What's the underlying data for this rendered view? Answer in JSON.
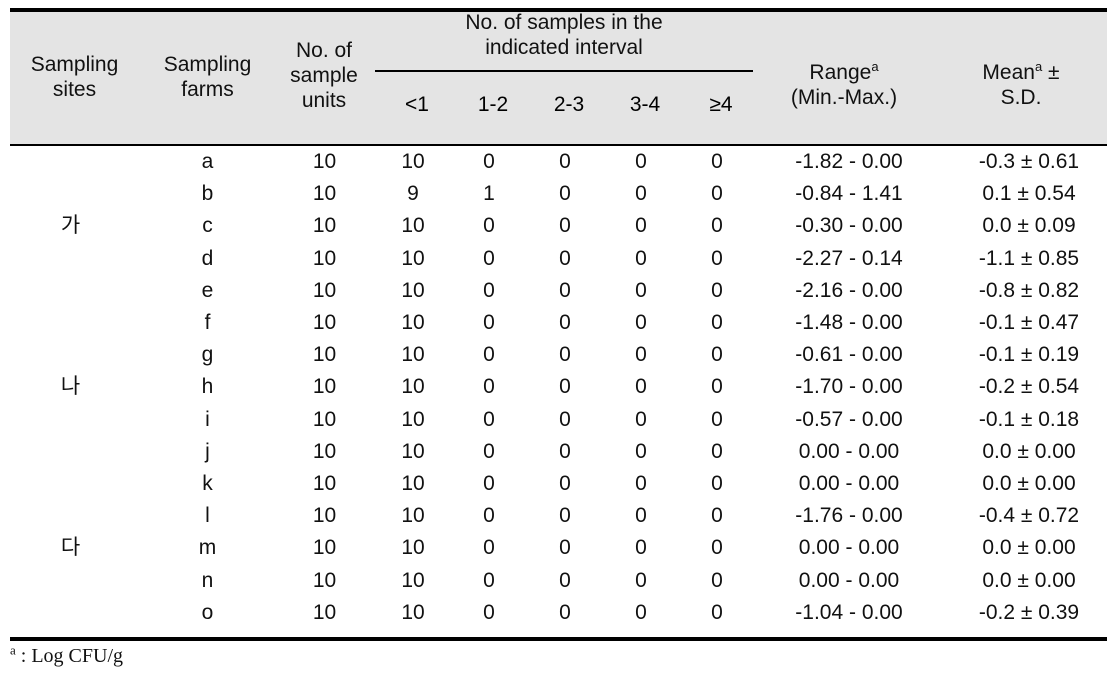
{
  "table": {
    "header": {
      "col_sites": "Sampling\nsites",
      "col_sites_line1": "Sampling",
      "col_sites_line2": "sites",
      "col_farms_line1": "Sampling",
      "col_farms_line2": "farms",
      "col_units_line1": "No. of",
      "col_units_line2": "sample",
      "col_units_line3": "units",
      "group_line1": "No.  of  samples  in  the",
      "group_line2": "indicated  interval",
      "intervals": [
        "<1",
        "1-2",
        "2-3",
        "3-4",
        "≥4"
      ],
      "range_line1": "Range",
      "range_sup": "a",
      "range_line2": "(Min.-Max.)",
      "mean_line1": "Mean",
      "mean_sup": "a",
      "mean_pm": "±",
      "mean_line2": "S.D."
    },
    "columns": [
      "Sampling sites",
      "Sampling farms",
      "No. of sample units",
      "<1",
      "1-2",
      "2-3",
      "3-4",
      "≥4",
      "Range (Min.-Max.)",
      "Mean ± S.D."
    ],
    "rows": [
      {
        "site": "",
        "farm": "a",
        "units": "10",
        "i0": "10",
        "i1": "0",
        "i2": "0",
        "i3": "0",
        "i4": "0",
        "range": "-1.82 -  0.00",
        "mean": "-0.3  ± 0.61"
      },
      {
        "site": "",
        "farm": "b",
        "units": "10",
        "i0": "9",
        "i1": "1",
        "i2": "0",
        "i3": "0",
        "i4": "0",
        "range": "-0.84 -  1.41",
        "mean": "0.1  ± 0.54"
      },
      {
        "site": "가",
        "farm": "c",
        "units": "10",
        "i0": "10",
        "i1": "0",
        "i2": "0",
        "i3": "0",
        "i4": "0",
        "range": "-0.30 -  0.00",
        "mean": "0.0  ± 0.09"
      },
      {
        "site": "",
        "farm": "d",
        "units": "10",
        "i0": "10",
        "i1": "0",
        "i2": "0",
        "i3": "0",
        "i4": "0",
        "range": "-2.27 -  0.14",
        "mean": "-1.1  ± 0.85"
      },
      {
        "site": "",
        "farm": "e",
        "units": "10",
        "i0": "10",
        "i1": "0",
        "i2": "0",
        "i3": "0",
        "i4": "0",
        "range": "-2.16 -  0.00",
        "mean": "-0.8  ± 0.82"
      },
      {
        "site": "",
        "farm": "f",
        "units": "10",
        "i0": "10",
        "i1": "0",
        "i2": "0",
        "i3": "0",
        "i4": "0",
        "range": "-1.48 -  0.00",
        "mean": "-0.1  ± 0.47"
      },
      {
        "site": "",
        "farm": "g",
        "units": "10",
        "i0": "10",
        "i1": "0",
        "i2": "0",
        "i3": "0",
        "i4": "0",
        "range": "-0.61 -  0.00",
        "mean": "-0.1  ± 0.19"
      },
      {
        "site": "나",
        "farm": "h",
        "units": "10",
        "i0": "10",
        "i1": "0",
        "i2": "0",
        "i3": "0",
        "i4": "0",
        "range": "-1.70 -  0.00",
        "mean": "-0.2  ± 0.54"
      },
      {
        "site": "",
        "farm": "i",
        "units": "10",
        "i0": "10",
        "i1": "0",
        "i2": "0",
        "i3": "0",
        "i4": "0",
        "range": "-0.57 -  0.00",
        "mean": "-0.1  ± 0.18"
      },
      {
        "site": "",
        "farm": "j",
        "units": "10",
        "i0": "10",
        "i1": "0",
        "i2": "0",
        "i3": "0",
        "i4": "0",
        "range": "0.00 -  0.00",
        "mean": "0.0  ± 0.00"
      },
      {
        "site": "",
        "farm": "k",
        "units": "10",
        "i0": "10",
        "i1": "0",
        "i2": "0",
        "i3": "0",
        "i4": "0",
        "range": "0.00 -  0.00",
        "mean": "0.0  ± 0.00"
      },
      {
        "site": "",
        "farm": "l",
        "units": "10",
        "i0": "10",
        "i1": "0",
        "i2": "0",
        "i3": "0",
        "i4": "0",
        "range": "-1.76 -  0.00",
        "mean": "-0.4  ± 0.72"
      },
      {
        "site": "다",
        "farm": "m",
        "units": "10",
        "i0": "10",
        "i1": "0",
        "i2": "0",
        "i3": "0",
        "i4": "0",
        "range": "0.00 -  0.00",
        "mean": "0.0  ± 0.00"
      },
      {
        "site": "",
        "farm": "n",
        "units": "10",
        "i0": "10",
        "i1": "0",
        "i2": "0",
        "i3": "0",
        "i4": "0",
        "range": "0.00 -  0.00",
        "mean": "0.0  ± 0.00"
      },
      {
        "site": "",
        "farm": "o",
        "units": "10",
        "i0": "10",
        "i1": "0",
        "i2": "0",
        "i3": "0",
        "i4": "0",
        "range": "-1.04 -  0.00",
        "mean": "-0.2  ± 0.39"
      }
    ],
    "footnote": {
      "sup": "a",
      "text": " :  Log  CFU/g"
    },
    "colors": {
      "header_bg": "#e4e4e4",
      "rule": "#000000",
      "text": "#111111",
      "page_bg": "#ffffff"
    }
  }
}
